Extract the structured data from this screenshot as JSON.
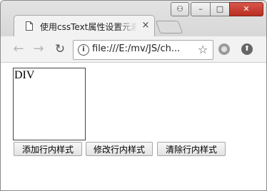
{
  "tab": {
    "title": "使用cssText属性设置元素",
    "close_glyph": "×"
  },
  "window_controls": {
    "user_glyph": "⚇",
    "min_glyph": "–",
    "max_glyph": "□",
    "close_glyph": "✕"
  },
  "toolbar": {
    "back_glyph": "←",
    "forward_glyph": "→",
    "reload_glyph": "↻",
    "info_glyph": "i",
    "url": "file:///E:/mv/JS/ch...",
    "star_glyph": "☆",
    "extension2_glyph": "⬆"
  },
  "page": {
    "div_text": "DIV",
    "buttons": [
      {
        "label": "添加行内样式"
      },
      {
        "label": "修改行内样式"
      },
      {
        "label": "清除行内样式"
      }
    ]
  }
}
